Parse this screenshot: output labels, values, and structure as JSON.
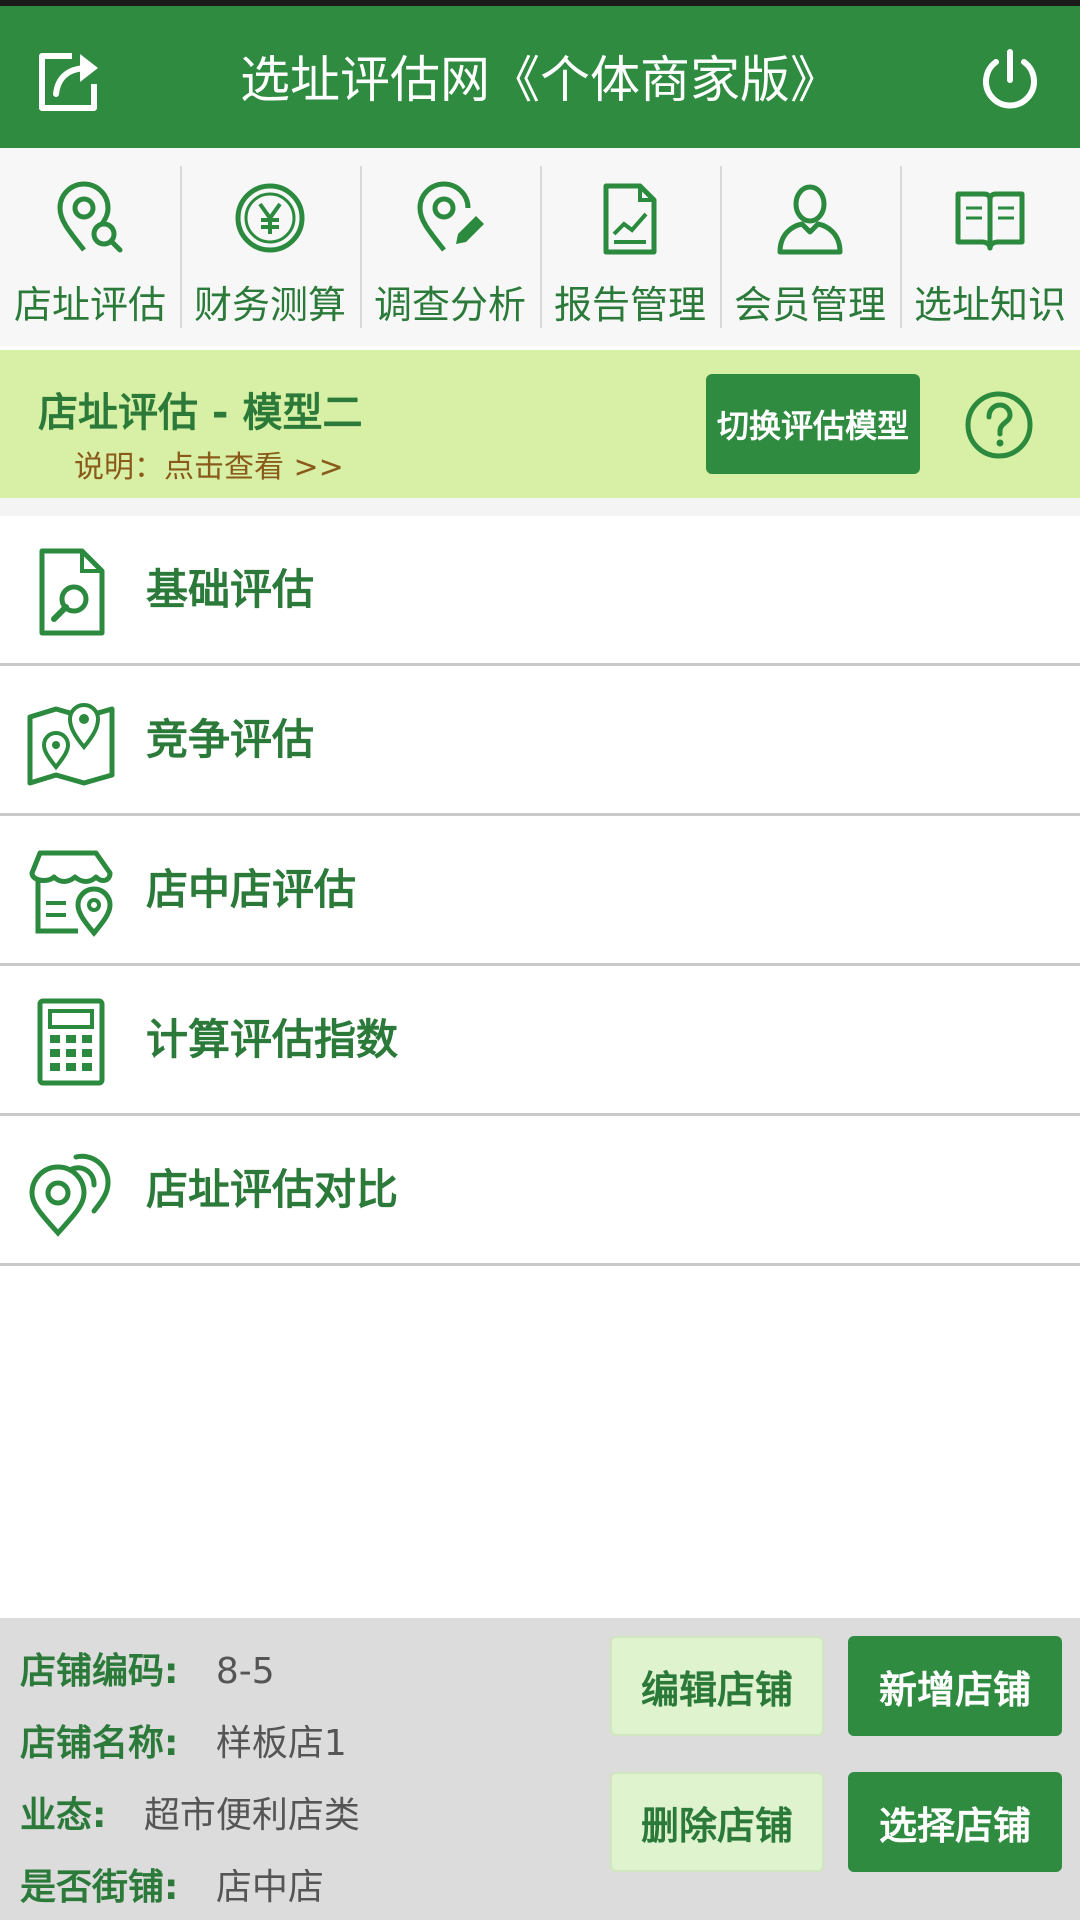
{
  "header": {
    "title": "选址评估网《个体商家版》",
    "share_icon": "share-icon",
    "power_icon": "power-icon"
  },
  "nav": {
    "items": [
      {
        "label": "店址评估",
        "icon": "location-search-icon"
      },
      {
        "label": "财务测算",
        "icon": "yen-coin-icon"
      },
      {
        "label": "调查分析",
        "icon": "location-edit-icon"
      },
      {
        "label": "报告管理",
        "icon": "report-icon"
      },
      {
        "label": "会员管理",
        "icon": "user-icon"
      },
      {
        "label": "选址知识",
        "icon": "book-icon"
      }
    ]
  },
  "model": {
    "title": "店址评估 - 模型二",
    "desc_label": "说明：",
    "desc_link": "点击查看 >>",
    "switch_label": "切换评估模型",
    "help_icon": "help-icon"
  },
  "menu": {
    "items": [
      {
        "label": "基础评估",
        "icon": "document-search-icon"
      },
      {
        "label": "竞争评估",
        "icon": "map-pins-icon"
      },
      {
        "label": "店中店评估",
        "icon": "store-location-icon"
      },
      {
        "label": "计算评估指数",
        "icon": "calculator-icon"
      },
      {
        "label": "店址评估对比",
        "icon": "compare-locations-icon"
      }
    ]
  },
  "store": {
    "code_label": "店铺编码:",
    "code_value": "8-5",
    "name_label": "店铺名称:",
    "name_value": "样板店1",
    "type_label": "业态:",
    "type_value": "超市便利店类",
    "street_label": "是否街铺:",
    "street_value": "店中店"
  },
  "actions": {
    "edit": "编辑店铺",
    "add": "新增店铺",
    "delete": "删除店铺",
    "select": "选择店铺"
  },
  "colors": {
    "primary": "#2e8b3f",
    "banner": "#d8f0a5",
    "footer": "#dcdcdc"
  }
}
